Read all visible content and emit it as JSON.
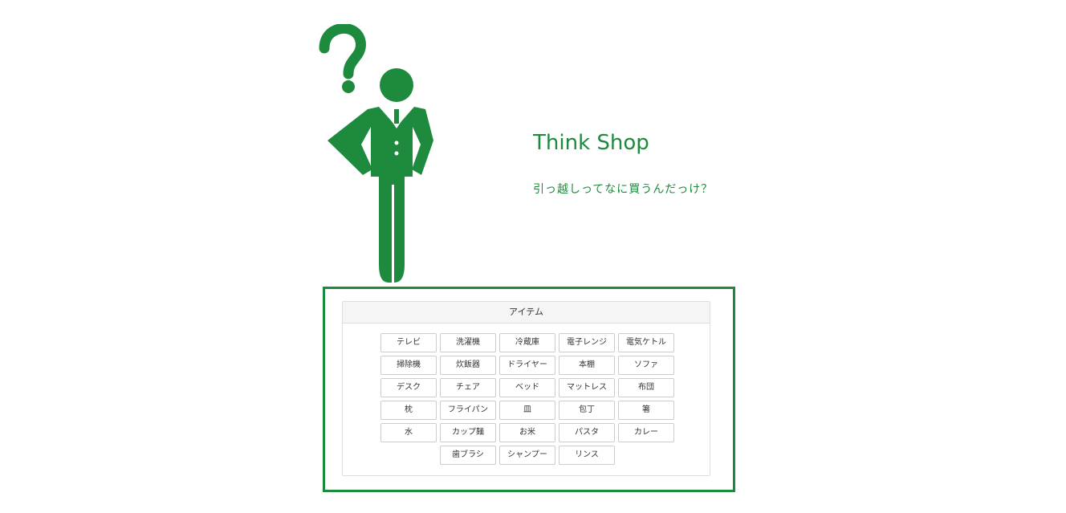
{
  "hero": {
    "title": "Think Shop",
    "tagline": "引っ越しってなに買うんだっけ？"
  },
  "theme": {
    "accent": "#1e8a3e"
  },
  "figure_icon": "thinking-man-icon",
  "items_panel": {
    "heading": "アイテム",
    "items": [
      "テレビ",
      "洗濯機",
      "冷蔵庫",
      "電子レンジ",
      "電気ケトル",
      "掃除機",
      "炊飯器",
      "ドライヤー",
      "本棚",
      "ソファ",
      "デスク",
      "チェア",
      "ベッド",
      "マットレス",
      "布団",
      "枕",
      "フライパン",
      "皿",
      "包丁",
      "箸",
      "水",
      "カップ麺",
      "お米",
      "パスタ",
      "カレー",
      "歯ブラシ",
      "シャンプー",
      "リンス"
    ]
  }
}
